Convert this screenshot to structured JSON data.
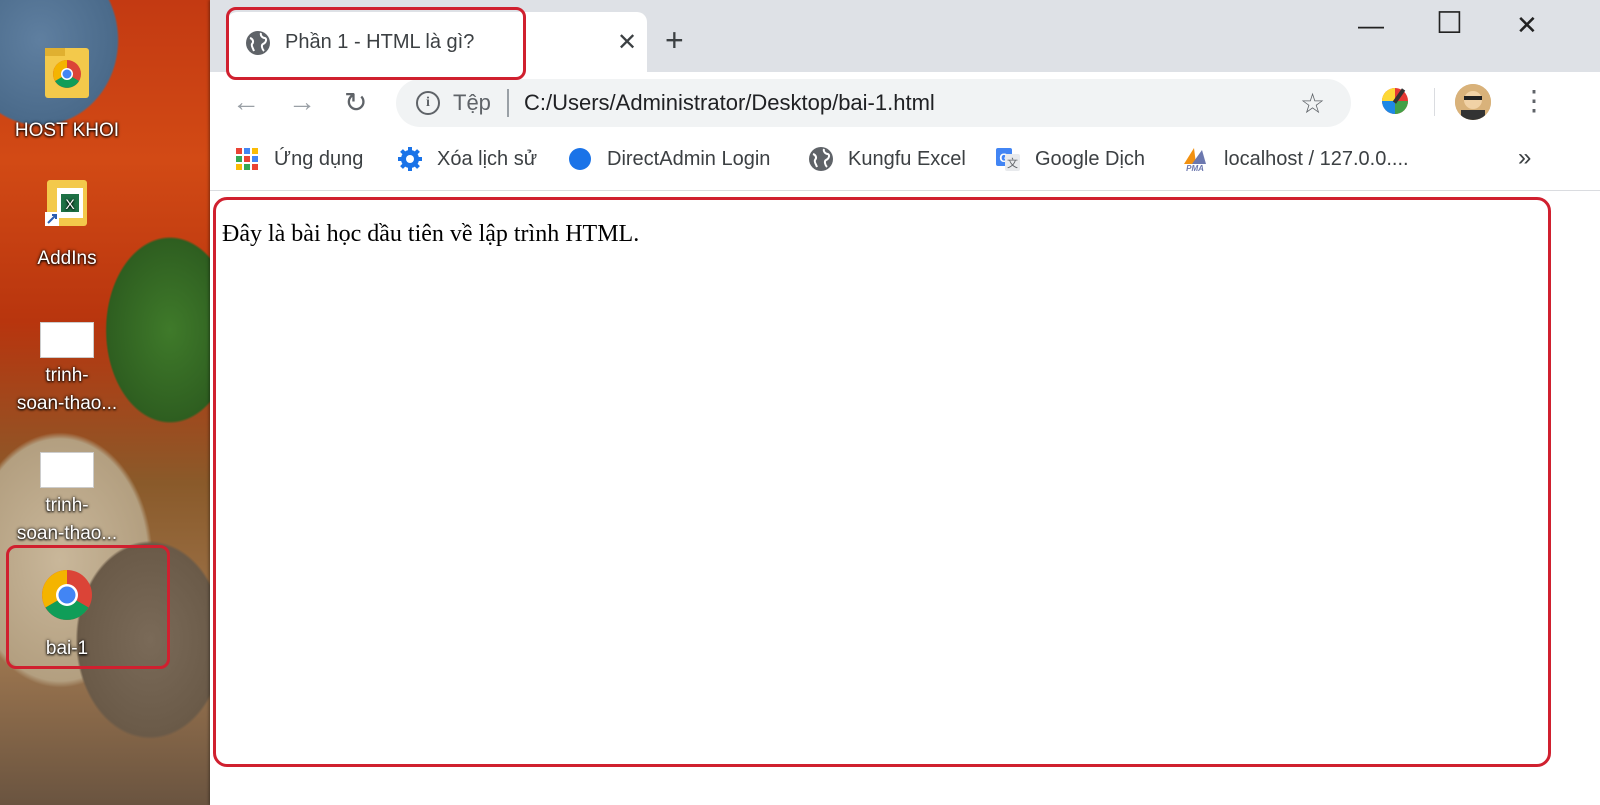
{
  "desktop": {
    "icons": [
      {
        "label": "HOST KHOI",
        "icon": "chrome-folder-icon"
      },
      {
        "label": "AddIns",
        "icon": "excel-folder-icon"
      },
      {
        "label_line1": "trinh-",
        "label_line2": "soan-thao...",
        "icon": "document-thumbnail-icon"
      },
      {
        "label_line1": "trinh-",
        "label_line2": "soan-thao...",
        "icon": "document-thumbnail-icon"
      },
      {
        "label": "bai-1",
        "icon": "chrome-icon"
      }
    ]
  },
  "browser": {
    "tab": {
      "title": "Phần 1 - HTML là gì?",
      "icon": "globe-icon",
      "close_symbol": "✕"
    },
    "new_tab_symbol": "+",
    "window_controls": {
      "minimize": "—",
      "maximize": "☐",
      "close": "✕"
    },
    "nav": {
      "back": "←",
      "forward": "→",
      "reload": "↻"
    },
    "omnibox": {
      "info_symbol": "i",
      "label": "Tệp",
      "url": "C:/Users/Administrator/Desktop/bai-1.html",
      "star": "☆"
    },
    "menu_symbol": "⋮",
    "bookmarks": [
      {
        "label": "Ứng dụng",
        "icon": "apps-grid-icon"
      },
      {
        "label": "Xóa lịch sử",
        "icon": "gear-icon"
      },
      {
        "label": "DirectAdmin Login",
        "icon": "blue-dot-icon"
      },
      {
        "label": "Kungfu Excel",
        "icon": "globe-icon"
      },
      {
        "label": "Google Dịch",
        "icon": "google-translate-icon"
      },
      {
        "label": "localhost / 127.0.0....",
        "icon": "phpmyadmin-icon"
      }
    ],
    "bookmarks_overflow": "»"
  },
  "page": {
    "text": "Đây là bài học dầu tiên về lập trình HTML."
  },
  "colors": {
    "highlight": "#d0202f",
    "tabbar": "#dee1e6",
    "omnibox": "#f1f3f4"
  }
}
